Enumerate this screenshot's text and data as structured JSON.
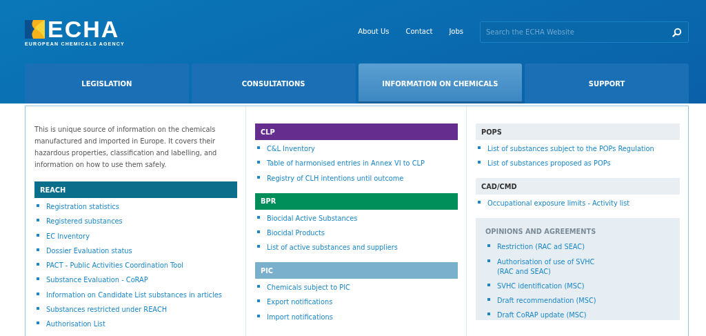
{
  "logo": {
    "name": "ECHA",
    "subtitle": "EUROPEAN CHEMICALS AGENCY"
  },
  "top_links": [
    "About Us",
    "Contact",
    "Jobs"
  ],
  "search": {
    "placeholder": "Search the ECHA Website"
  },
  "tabs": [
    {
      "label": "LEGISLATION",
      "selected": false
    },
    {
      "label": "CONSULTATIONS",
      "selected": false
    },
    {
      "label": "INFORMATION ON CHEMICALS",
      "selected": true
    },
    {
      "label": "SUPPORT",
      "selected": false
    }
  ],
  "menu": {
    "columns": [
      {
        "intro": "This is unique source of information on the chemicals manufactured and imported in Europe. It covers their hazardous properties, classification and labelling, and information on how to use them safely.",
        "sections": [
          {
            "title": "REACH",
            "kind": "solid",
            "color": "#0b6e8a",
            "items": [
              "Registration statistics",
              "Registered substances",
              "EC Inventory",
              "Dossier Evaluation status",
              "PACT - Public Activities Coordination Tool",
              "Substance Evaluation - CoRAP",
              "Information on Candidate List substances in articles",
              "Substances restricted under REACH",
              "Authorisation List"
            ]
          }
        ]
      },
      {
        "sections": [
          {
            "title": "CLP",
            "kind": "solid",
            "color": "#652d8e",
            "items": [
              "C&L Inventory",
              "Table of harmonised entries in Annex VI to CLP",
              "Registry of CLH intentions until outcome"
            ]
          },
          {
            "title": "BPR",
            "kind": "solid",
            "color": "#008f5a",
            "items": [
              "Biocidal Active Substances",
              "Biocidal Products",
              "List of active substances and suppliers"
            ]
          },
          {
            "title": "PIC",
            "kind": "solid",
            "color": "#7ab0cc",
            "items": [
              "Chemicals subject to PIC",
              "Export notifications",
              "Import notifications"
            ]
          }
        ]
      },
      {
        "sections": [
          {
            "title": "POPS",
            "kind": "light",
            "items": [
              "List of substances subject to the POPs Regulation",
              "List of substances proposed as POPs"
            ]
          },
          {
            "title": "CAD/CMD",
            "kind": "light",
            "items": [
              "Occupational exposure limits - Activity list"
            ]
          },
          {
            "title": "OPINIONS AND AGREEMENTS",
            "kind": "boxed",
            "items": [
              "Restriction (RAC ad SEAC)",
              "Authorisation of use of SVHC (RAC and SEAC)",
              "SVHC identification (MSC)",
              "Draft recommendation (MSC)",
              "Draft CoRAP update (MSC)"
            ]
          }
        ]
      }
    ]
  }
}
